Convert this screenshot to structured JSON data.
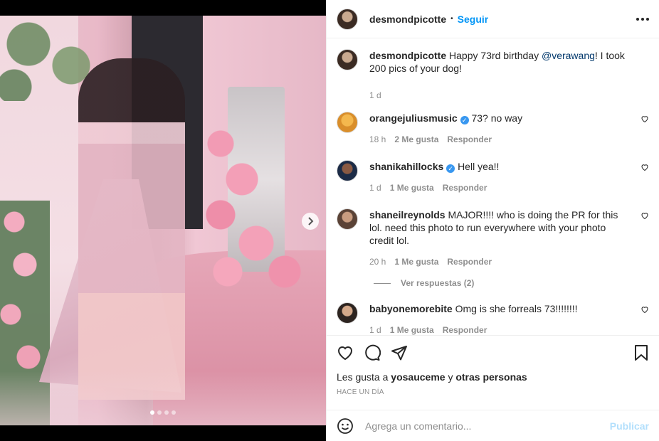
{
  "post": {
    "author": "desmondpicotte",
    "separator": "•",
    "follow_label": "Seguir",
    "caption_author": "desmondpicotte",
    "caption_text_1": " Happy 73rd birthday ",
    "caption_mention": "@verawang",
    "caption_text_2": "! I took 200 pics of your dog!",
    "caption_time": "1 d",
    "carousel": {
      "dots": 4,
      "active_index": 0
    }
  },
  "comments": [
    {
      "user": "orangejuliusmusic",
      "verified": true,
      "text": "73? no way",
      "time": "18 h",
      "likes": "2 Me gusta",
      "reply": "Responder"
    },
    {
      "user": "shanikahillocks",
      "verified": true,
      "text": "Hell yea!!",
      "time": "1 d",
      "likes": "1 Me gusta",
      "reply": "Responder"
    },
    {
      "user": "shaneilreynolds",
      "verified": false,
      "text": "MAJOR!!!! who is doing the PR for this lol. need this photo to run everywhere with your photo credit lol.",
      "time": "20 h",
      "likes": "1 Me gusta",
      "reply": "Responder",
      "view_replies": "Ver respuestas (2)"
    },
    {
      "user": "babyonemorebite",
      "verified": false,
      "text": "Omg is she forreals 73!!!!!!!!",
      "time": "1 d",
      "likes": "1 Me gusta",
      "reply": "Responder"
    }
  ],
  "likes_line": {
    "prefix": "Les gusta a ",
    "user": "yosauceme",
    "mid": " y ",
    "others": "otras personas"
  },
  "posted_time": "HACE UN DÍA",
  "add_comment": {
    "placeholder": "Agrega un comentario...",
    "publish_label": "Publicar"
  },
  "verified_glyph": "✓",
  "colors": {
    "accent": "#0095f6",
    "publish_disabled": "#b2dffc",
    "muted": "#8e8e8e"
  }
}
